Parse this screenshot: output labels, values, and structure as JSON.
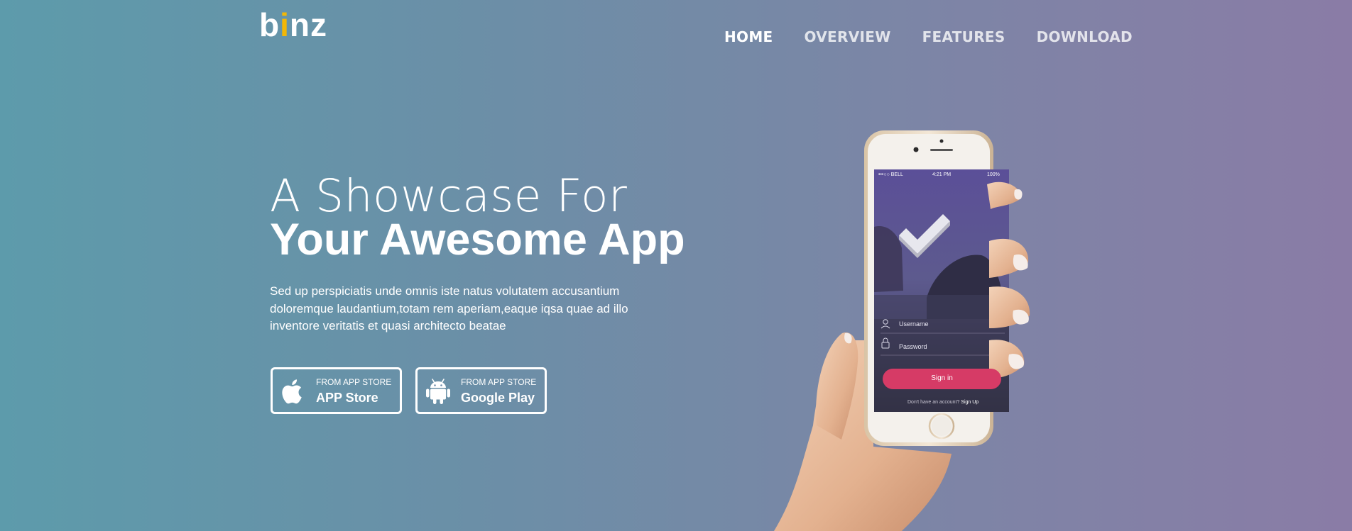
{
  "brand": {
    "logo_prefix": "b",
    "logo_accent": "i",
    "logo_suffix": "nz",
    "accent_color": "#f2b705"
  },
  "nav": {
    "items": [
      {
        "label": "HOME",
        "active": true
      },
      {
        "label": "OVERVIEW",
        "active": false
      },
      {
        "label": "FEATURES",
        "active": false
      },
      {
        "label": "DOWNLOAD",
        "active": false
      }
    ]
  },
  "hero": {
    "heading_light": "A Showcase For",
    "heading_bold": "Your Awesome App",
    "description": "Sed up perspiciatis unde omnis iste natus volutatem accusantium doloremque laudantium,totam rem aperiam,eaque iqsa quae ad illo inventore veritatis et quasi architecto beatae",
    "gradient_colors": [
      "#5d9bab",
      "#8a7ca6"
    ]
  },
  "store_buttons": [
    {
      "small": "FROM APP STORE",
      "big": "APP Store",
      "icon": "apple-icon"
    },
    {
      "small": "FROM APP STORE",
      "big": "Google Play",
      "icon": "android-icon"
    }
  ],
  "phone_screen": {
    "carrier": "•••○○ BELL",
    "time": "4:21 PM",
    "battery": "100%",
    "username_placeholder": "Username",
    "password_placeholder": "Password",
    "signin_label": "Sign in",
    "footer_text": "Don't have an account?",
    "footer_link": "Sign Up",
    "signin_color": "#d63b66"
  }
}
